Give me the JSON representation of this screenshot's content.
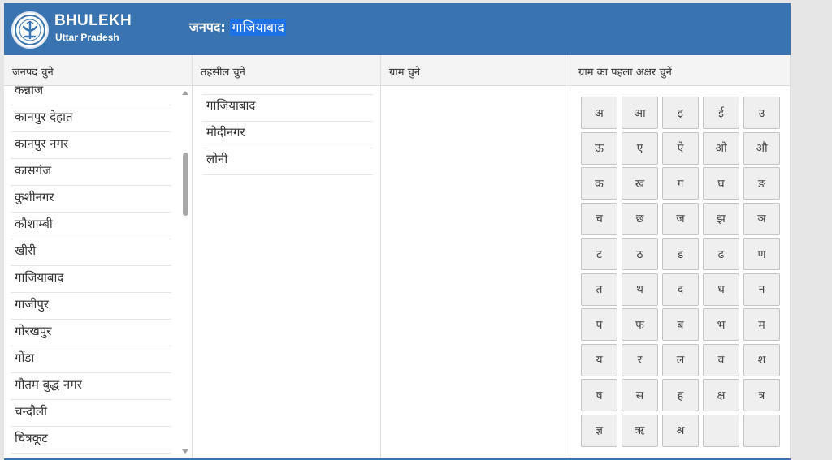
{
  "brand": {
    "title": "BHULEKH",
    "subtitle": "Uttar Pradesh"
  },
  "header": {
    "district_label": "जनपद:",
    "district_value": "गाजियाबाद"
  },
  "columns": {
    "district": "जनपद चुने",
    "tehsil": "तहसील चुने",
    "village": "ग्राम चुने",
    "first_letter": "ग्राम का पहला अक्षर चुनें"
  },
  "districts": [
    "कन्नौज",
    "कानपुर देहात",
    "कानपुर नगर",
    "कासगंज",
    "कुशीनगर",
    "कौशाम्बी",
    "खीरी",
    "गाजियाबाद",
    "गाजीपुर",
    "गोरखपुर",
    "गोंडा",
    "गौतम बुद्ध नगर",
    "चन्दौली",
    "चित्रकूट"
  ],
  "tehsils": [
    "गाजियाबाद",
    "मोदीनगर",
    "लोनी"
  ],
  "letters": [
    "अ",
    "आ",
    "इ",
    "ई",
    "उ",
    "ऊ",
    "ए",
    "ऐ",
    "ओ",
    "औ",
    "क",
    "ख",
    "ग",
    "घ",
    "ङ",
    "च",
    "छ",
    "ज",
    "झ",
    "ञ",
    "ट",
    "ठ",
    "ड",
    "ढ",
    "ण",
    "त",
    "थ",
    "द",
    "ध",
    "न",
    "प",
    "फ",
    "ब",
    "भ",
    "म",
    "य",
    "र",
    "ल",
    "व",
    "श",
    "ष",
    "स",
    "ह",
    "क्ष",
    "त्र",
    "ज्ञ",
    "ऋ",
    "श्र",
    "",
    ""
  ],
  "colors": {
    "header": "#3a74b0",
    "selection": "#1e72e6"
  }
}
